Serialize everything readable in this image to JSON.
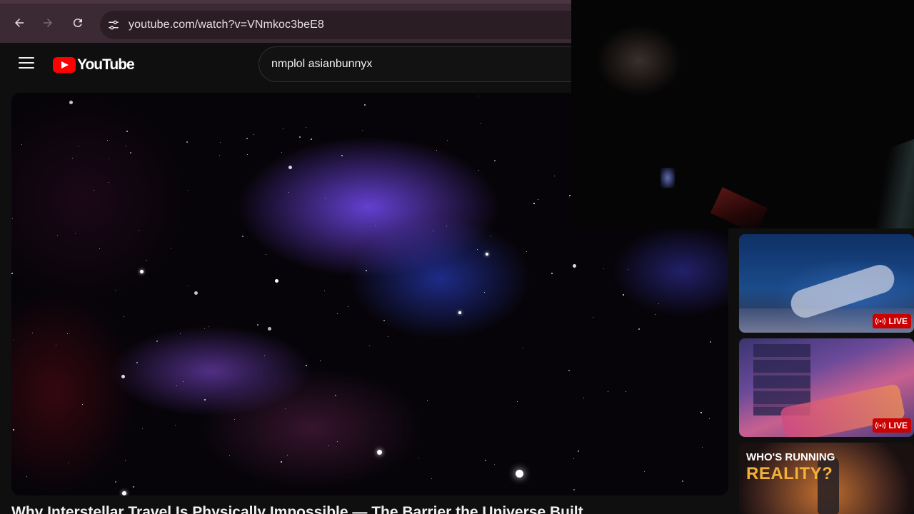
{
  "browser": {
    "url": "youtube.com/watch?v=VNmkoc3beE8"
  },
  "header": {
    "logo_text": "YouTube",
    "search_value": "nmplol asianbunnyx"
  },
  "video": {
    "title": "Why Interstellar Travel Is Physically Impossible — The Barrier the Universe Built"
  },
  "related": [
    {
      "badge": "LIVE"
    },
    {
      "badge": "LIVE"
    },
    {
      "overlay_line1": "WHO'S RUNNING",
      "overlay_line2": "REALITY?"
    }
  ],
  "colors": {
    "youtube_red": "#ff0000",
    "live_red": "#cc0000",
    "background": "#0f0f0f",
    "accent_gold": "#f2b13a"
  },
  "icons": [
    "back-arrow-icon",
    "forward-arrow-icon",
    "reload-icon",
    "site-info-icon",
    "menu-icon",
    "youtube-logo-icon",
    "live-broadcast-icon"
  ]
}
